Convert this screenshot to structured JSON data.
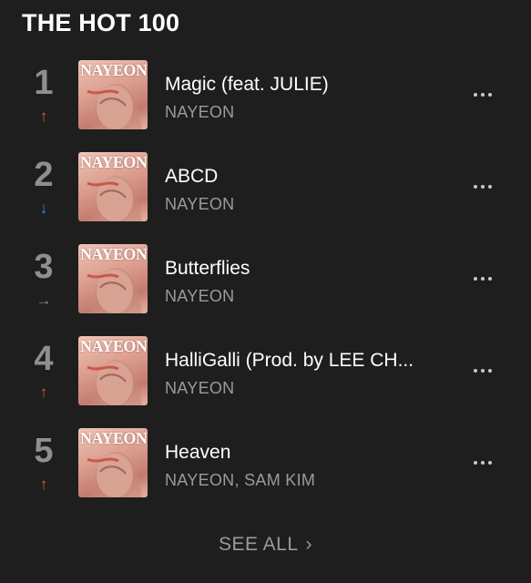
{
  "header": {
    "title": "THE HOT 100"
  },
  "chart": {
    "items": [
      {
        "rank": "1",
        "trend": "up",
        "trend_symbol": "↑",
        "song": "Magic (feat. JULIE)",
        "artist": "NAYEON",
        "art_text": "NAYEON"
      },
      {
        "rank": "2",
        "trend": "down",
        "trend_symbol": "↓",
        "song": "ABCD",
        "artist": "NAYEON",
        "art_text": "NAYEON"
      },
      {
        "rank": "3",
        "trend": "same",
        "trend_symbol": "→",
        "song": "Butterflies",
        "artist": "NAYEON",
        "art_text": "NAYEON"
      },
      {
        "rank": "4",
        "trend": "up",
        "trend_symbol": "↑",
        "song": "HalliGalli (Prod. by LEE CH...",
        "artist": "NAYEON",
        "art_text": "NAYEON"
      },
      {
        "rank": "5",
        "trend": "up",
        "trend_symbol": "↑",
        "song": "Heaven",
        "artist": "NAYEON, SAM KIM",
        "art_text": "NAYEON"
      }
    ]
  },
  "footer": {
    "see_all_label": "SEE ALL",
    "chevron": "›"
  },
  "colors": {
    "up": "#e8553e",
    "down": "#3a8ee6",
    "same": "#8e8e93",
    "background": "#1e1e1e"
  },
  "icons": {
    "more": "ellipsis-icon",
    "trend_up": "arrow-up-icon",
    "trend_down": "arrow-down-icon",
    "trend_same": "arrow-right-icon"
  }
}
